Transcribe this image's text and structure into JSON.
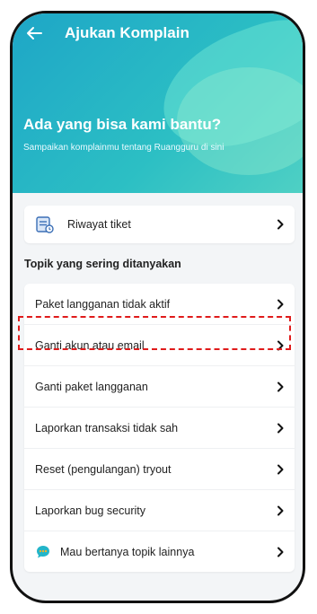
{
  "header": {
    "title": "Ajukan Komplain",
    "headline": "Ada yang bisa kami bantu?",
    "subline": "Sampaikan komplainmu tentang Ruangguru di sini"
  },
  "ticket": {
    "label": "Riwayat tiket",
    "icon": "ticket-icon"
  },
  "faq": {
    "title": "Topik yang sering ditanyakan",
    "items": [
      {
        "label": "Paket langganan tidak aktif"
      },
      {
        "label": "Ganti akun atau email"
      },
      {
        "label": "Ganti paket langganan"
      },
      {
        "label": "Laporkan transaksi tidak sah"
      },
      {
        "label": "Reset (pengulangan) tryout"
      },
      {
        "label": "Laporkan bug security"
      },
      {
        "label": "Mau bertanya topik lainnya",
        "icon": "chat-bubble-icon"
      }
    ]
  },
  "colors": {
    "hero_start": "#1ea6c7",
    "hero_end": "#4fd0c4",
    "highlight": "#e01b1b"
  }
}
